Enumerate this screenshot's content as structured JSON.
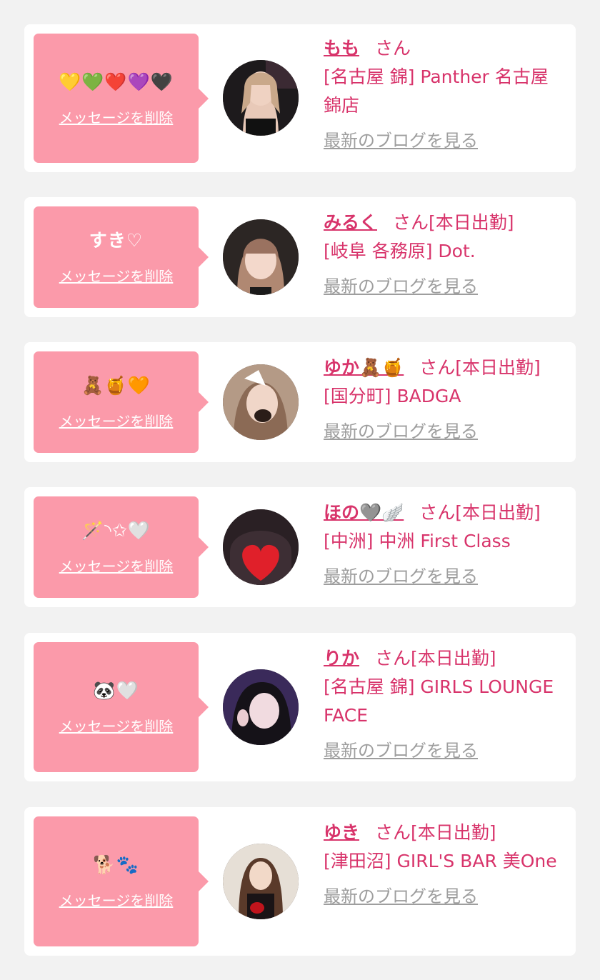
{
  "common": {
    "delete_label": "メッセージを削除",
    "blog_label": "最新のブログを見る",
    "honorific": "さん"
  },
  "colors": {
    "background": "#f2f2f2",
    "card": "#ffffff",
    "bubble": "#fb9aaa",
    "accent": "#d8346b",
    "link_gray": "#9e9e9e"
  },
  "items": [
    {
      "message": "💛💚❤️💜🖤",
      "name": "もも",
      "status": "",
      "shop": "[名古屋 錦] Panther 名古屋錦店",
      "avatar_icon": "avatar-photo-momo"
    },
    {
      "message": "すき♡",
      "name": "みるく",
      "status": "[本日出勤]",
      "shop": "[岐阜 各務原] Dot.",
      "avatar_icon": "avatar-photo-miruku"
    },
    {
      "message": "🧸🍯🧡",
      "name": "ゆか🧸🍯",
      "status": "[本日出勤]",
      "shop": "[国分町] BADGA",
      "avatar_icon": "avatar-photo-yuka"
    },
    {
      "message": "🪄◝✩🤍",
      "name": "ほの🩶🪽",
      "status": "[本日出勤]",
      "shop": "[中洲] 中洲 First Class",
      "avatar_icon": "avatar-photo-hono"
    },
    {
      "message": "🐼🤍",
      "name": "りか",
      "status": "[本日出勤]",
      "shop": "[名古屋 錦] GIRLS LOUNGE FACE",
      "avatar_icon": "avatar-photo-rika"
    },
    {
      "message": "🐕🐾",
      "name": "ゆき",
      "status": "[本日出勤]",
      "shop": "[津田沼] GIRL'S BAR 美One",
      "avatar_icon": "avatar-photo-yuki"
    }
  ]
}
